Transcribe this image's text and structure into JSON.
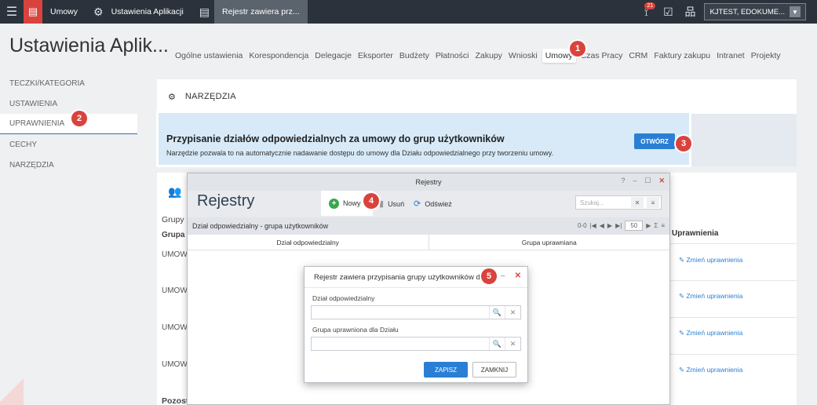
{
  "topbar": {
    "module": "Umowy",
    "settings": "Ustawienia Aplikacji",
    "active_tab": "Rejestr zawiera prz...",
    "notifications": "21",
    "user": "KJTEST, EDOKUME..."
  },
  "page": {
    "title": "Ustawienia Aplik...",
    "tabs": [
      "Ogólne ustawienia",
      "Korespondencja",
      "Delegacje",
      "Eksporter",
      "Budżety",
      "Płatności",
      "Zakupy",
      "Wnioski",
      "Umowy",
      "Czas Pracy",
      "CRM",
      "Faktury zakupu",
      "Intranet",
      "Projekty"
    ]
  },
  "sidebar": {
    "items": [
      "TECZKI/KATEGORIA",
      "USTAWIENIA",
      "UPRAWNIENIA",
      "CECHY",
      "NARZĘDZIA"
    ]
  },
  "narzedzia": {
    "title": "NARZĘDZIA"
  },
  "info": {
    "heading": "Przypisanie działów odpowiedzialnych za umowy do grup użytkowników",
    "desc": "Narzędzie pozwala to na automatycznie nadawanie dostępu do umowy dla Działu odpowiedzialnego przy tworzeniu umowy.",
    "button": "OTWÓRZ"
  },
  "bg_panel": {
    "group_label": "Grupy",
    "col_label": "Grupa",
    "rows": [
      "UMOW",
      "UMOW",
      "UMOW",
      "UMOW"
    ],
    "right_header": "Uprawnienia",
    "change_label": "Zmień uprawnienia",
    "footer_label": "Pozost"
  },
  "registry_window": {
    "title": "Rejestry",
    "big_title": "Rejestry",
    "new": "Nowy",
    "delete": "Usuń",
    "refresh": "Odśwież",
    "search_placeholder": "Szukaj...",
    "subtitle": "Dział odpowiedzialny - grupa użytkowników",
    "pager_range": "0-0",
    "page_size": "50",
    "col1": "Dział odpowiedzialny",
    "col2": "Grupa uprawniana"
  },
  "modal": {
    "title": "Rejestr zawiera przypisania grupy użytkowników do ...",
    "field1_label": "Dział odpowiedzialny",
    "field2_label": "Grupa uprawniona dla Działu",
    "save": "ZAPISZ",
    "close": "ZAMKNIJ"
  },
  "step_badges": [
    "1",
    "2",
    "3",
    "4",
    "5"
  ],
  "colors": {
    "accent": "#2a7fd4",
    "badge": "#d9433d",
    "topbar": "#2b323b"
  }
}
